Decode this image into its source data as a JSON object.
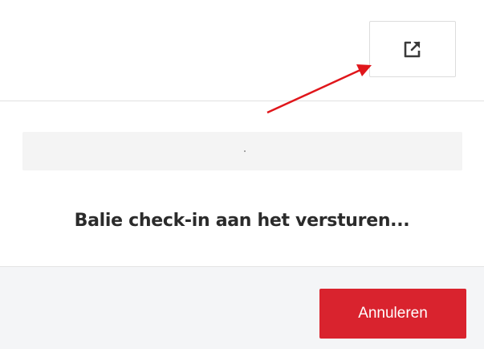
{
  "header": {
    "open_external_icon": "external-link-icon"
  },
  "progress": {
    "value": 0
  },
  "status": {
    "message": "Balie check-in aan het versturen..."
  },
  "footer": {
    "cancel_label": "Annuleren"
  },
  "colors": {
    "primary_button": "#d9232e",
    "annotation_arrow": "#e0161b",
    "icon": "#3a3a3a"
  }
}
